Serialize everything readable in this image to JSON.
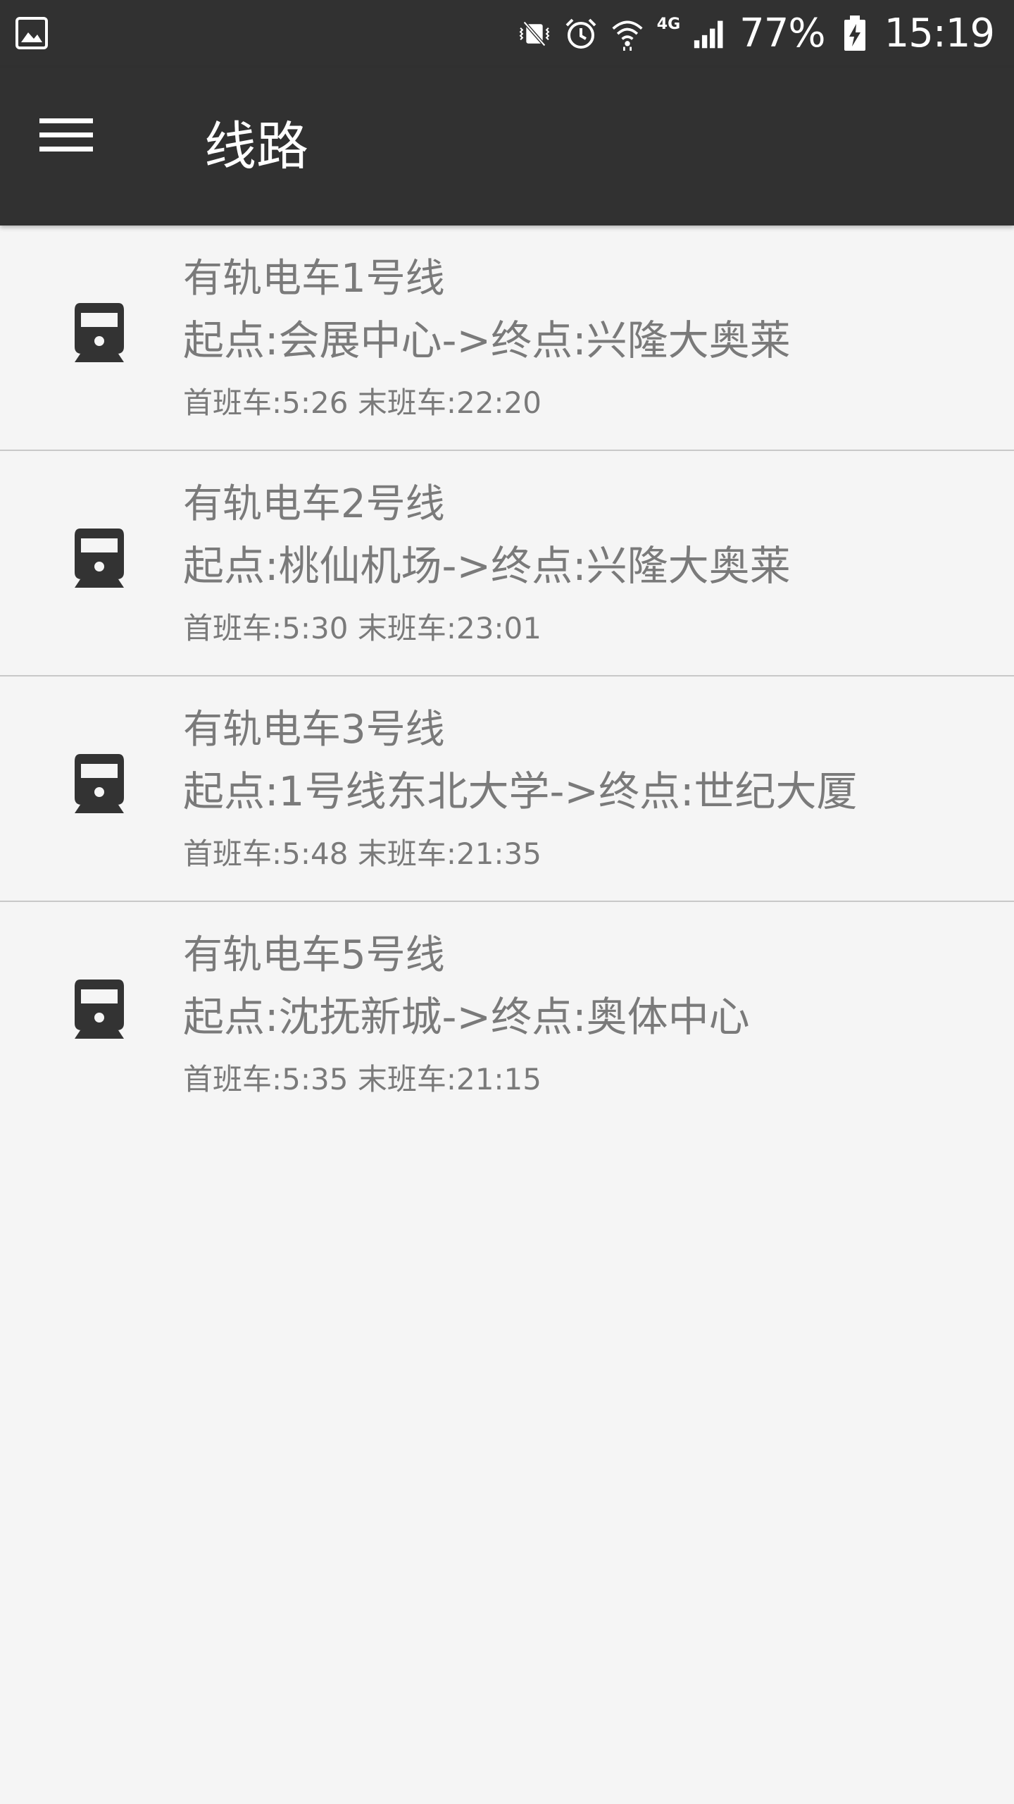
{
  "status_bar": {
    "battery_percent": "77%",
    "time": "15:19",
    "network": "4G",
    "icons": [
      "image-notification-icon",
      "vibrate-mute-icon",
      "alarm-icon",
      "wifi-icon",
      "signal-icon",
      "battery-charging-icon"
    ]
  },
  "app_bar": {
    "title": "线路",
    "menu_icon": "hamburger-menu-icon"
  },
  "routes": [
    {
      "name": "有轨电车1号线",
      "stops": "起点:会展中心->终点:兴隆大奥莱",
      "times": "首班车:5:26 末班车:22:20",
      "icon": "tram-icon"
    },
    {
      "name": "有轨电车2号线",
      "stops": "起点:桃仙机场->终点:兴隆大奥莱",
      "times": "首班车:5:30 末班车:23:01",
      "icon": "tram-icon"
    },
    {
      "name": "有轨电车3号线",
      "stops": "起点:1号线东北大学->终点:世纪大厦",
      "times": "首班车:5:48 末班车:21:35",
      "icon": "tram-icon"
    },
    {
      "name": "有轨电车5号线",
      "stops": "起点:沈抚新城->终点:奥体中心",
      "times": "首班车:5:35 末班车:21:15",
      "icon": "tram-icon"
    }
  ],
  "colors": {
    "toolbar": "#313131",
    "background": "#f5f5f5",
    "text_secondary": "#7a7a7a",
    "icon": "#333333",
    "divider": "#c8c8c8"
  }
}
